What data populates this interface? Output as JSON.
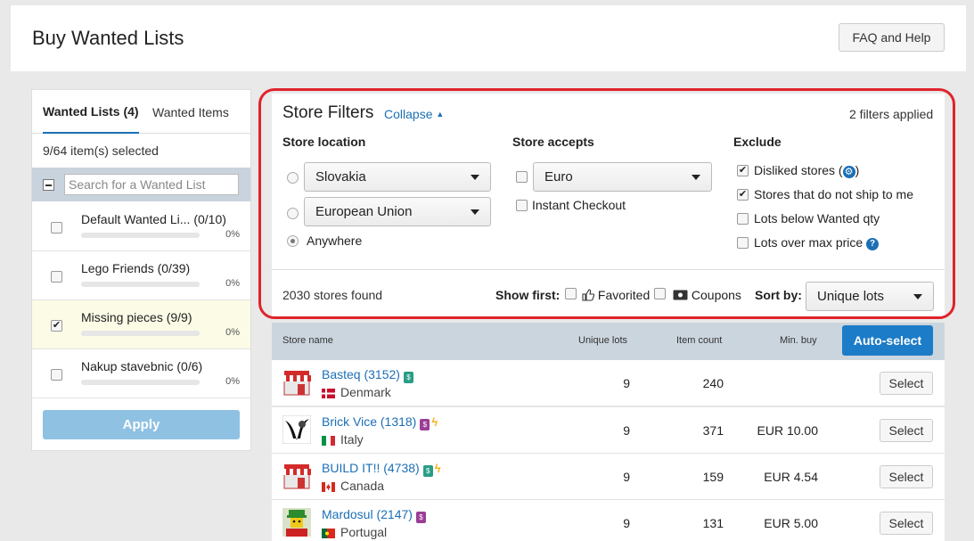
{
  "header": {
    "title": "Buy Wanted Lists",
    "faq_label": "FAQ and Help"
  },
  "left": {
    "tab_lists": "Wanted Lists (4)",
    "tab_items": "Wanted Items",
    "selected_text": "9/64 item(s) selected",
    "search_placeholder": "Search for a Wanted List",
    "lists": [
      {
        "name": "Default Wanted Li... (0/10)",
        "checked": false,
        "progress_pct": 0,
        "pct": "0%"
      },
      {
        "name": "Lego Friends  (0/39)",
        "checked": false,
        "progress_pct": 0,
        "pct": "0%"
      },
      {
        "name": "Missing pieces  (9/9)",
        "checked": true,
        "progress_pct": 0,
        "pct": "0%"
      },
      {
        "name": "Nakup stavebnic  (0/6)",
        "checked": false,
        "progress_pct": 0,
        "pct": "0%"
      }
    ],
    "apply_label": "Apply"
  },
  "filters": {
    "title": "Store Filters",
    "collapse_label": "Collapse",
    "applied": "2 filters applied",
    "location_head": "Store location",
    "location_country": "Slovakia",
    "location_region": "European Union",
    "location_anywhere": "Anywhere",
    "accepts_head": "Store accepts",
    "currency": "Euro",
    "instant_checkout": "Instant Checkout",
    "exclude_head": "Exclude",
    "exclude": {
      "disliked": "Disliked stores (",
      "disliked_close": ")",
      "no_ship": "Stores that do not ship to me",
      "below_qty": "Lots below Wanted qty",
      "over_price": "Lots over max price"
    },
    "stores_found": "2030 stores found",
    "show_first": "Show first:",
    "favorited": "Favorited",
    "coupons": "Coupons",
    "sort_by": "Sort by:",
    "sort_value": "Unique lots"
  },
  "table": {
    "headers": {
      "store": "Store name",
      "unique": "Unique lots",
      "count": "Item count",
      "min": "Min. buy"
    },
    "auto_select": "Auto-select",
    "select_label": "Select",
    "rows": [
      {
        "store": "Basteq (3152)",
        "country": "Denmark",
        "unique": "9",
        "count": "240",
        "min": ""
      },
      {
        "store": "Brick Vice (1318)",
        "country": "Italy",
        "unique": "9",
        "count": "371",
        "min": "EUR 10.00"
      },
      {
        "store": "BUILD IT!! (4738)",
        "country": "Canada",
        "unique": "9",
        "count": "159",
        "min": "EUR 4.54"
      },
      {
        "store": "Mardosul (2147)",
        "country": "Portugal",
        "unique": "9",
        "count": "131",
        "min": "EUR 5.00"
      }
    ]
  },
  "colors": {
    "accent": "#1c6fb5",
    "highlight_ring": "#e0232c",
    "apply_disabled": "#8fc1e3",
    "header_band": "#cbd5de"
  }
}
